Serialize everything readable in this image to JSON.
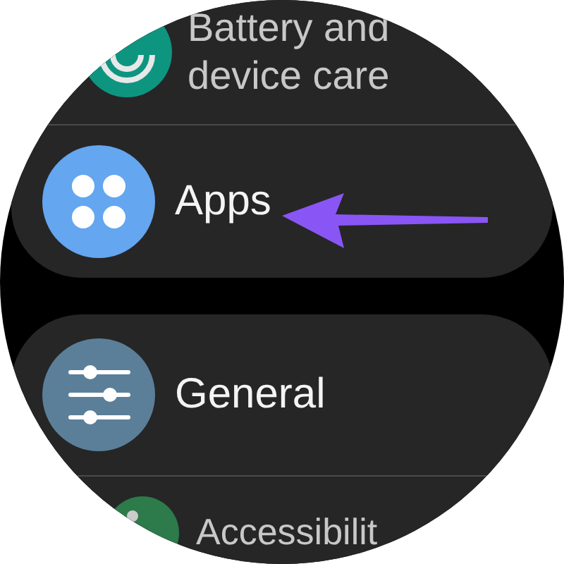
{
  "groups": [
    {
      "items": [
        {
          "label": "Battery and device care"
        },
        {
          "label": "Apps"
        }
      ]
    },
    {
      "items": [
        {
          "label": "General"
        },
        {
          "label": "Accessibilit"
        }
      ]
    }
  ]
}
